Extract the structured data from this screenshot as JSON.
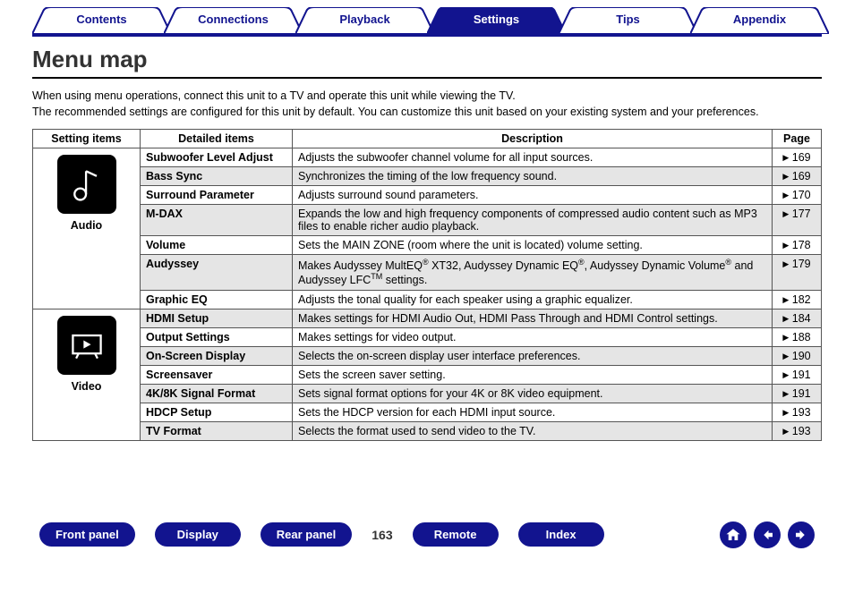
{
  "tabs": [
    {
      "label": "Contents",
      "active": false
    },
    {
      "label": "Connections",
      "active": false
    },
    {
      "label": "Playback",
      "active": false
    },
    {
      "label": "Settings",
      "active": true
    },
    {
      "label": "Tips",
      "active": false
    },
    {
      "label": "Appendix",
      "active": false
    }
  ],
  "title": "Menu map",
  "intro_line1": "When using menu operations, connect this unit to a TV and operate this unit while viewing the TV.",
  "intro_line2": "The recommended settings are configured for this unit by default. You can customize this unit based on your existing system and your preferences.",
  "headers": {
    "setting": "Setting items",
    "detail": "Detailed items",
    "desc": "Description",
    "page": "Page"
  },
  "categories": [
    {
      "name": "Audio",
      "icon": "audio",
      "rows": [
        {
          "shaded": false,
          "detail": "Subwoofer Level Adjust",
          "desc_html": "Adjusts the subwoofer channel volume for all input sources.",
          "page": "169"
        },
        {
          "shaded": true,
          "detail": "Bass Sync",
          "desc_html": "Synchronizes the timing of the low frequency sound.",
          "page": "169"
        },
        {
          "shaded": false,
          "detail": "Surround Parameter",
          "desc_html": "Adjusts surround sound parameters.",
          "page": "170"
        },
        {
          "shaded": true,
          "detail": "M-DAX",
          "desc_html": "Expands the low and high frequency components of compressed audio content such as MP3 files to enable richer audio playback.",
          "page": "177"
        },
        {
          "shaded": false,
          "detail": "Volume",
          "desc_html": "Sets the MAIN ZONE (room where the unit is located) volume setting.",
          "page": "178"
        },
        {
          "shaded": true,
          "detail": "Audyssey",
          "desc_html": "Makes Audyssey MultEQ<sup>®</sup> XT32, Audyssey Dynamic EQ<sup>®</sup>, Audyssey Dynamic Volume<sup>®</sup> and Audyssey LFC<sup>TM</sup> settings.",
          "page": "179"
        },
        {
          "shaded": false,
          "detail": "Graphic EQ",
          "desc_html": "Adjusts the tonal quality for each speaker using a graphic equalizer.",
          "page": "182"
        }
      ]
    },
    {
      "name": "Video",
      "icon": "video",
      "rows": [
        {
          "shaded": true,
          "detail": "HDMI Setup",
          "desc_html": "Makes settings for HDMI Audio Out, HDMI Pass Through and HDMI Control settings.",
          "page": "184"
        },
        {
          "shaded": false,
          "detail": "Output Settings",
          "desc_html": "Makes settings for video output.",
          "page": "188"
        },
        {
          "shaded": true,
          "detail": "On-Screen Display",
          "desc_html": "Selects the on-screen display user interface preferences.",
          "page": "190"
        },
        {
          "shaded": false,
          "detail": "Screensaver",
          "desc_html": "Sets the screen saver setting.",
          "page": "191"
        },
        {
          "shaded": true,
          "detail": "4K/8K Signal Format",
          "desc_html": "Sets signal format options for your 4K or 8K video equipment.",
          "page": "191"
        },
        {
          "shaded": false,
          "detail": "HDCP Setup",
          "desc_html": "Sets the HDCP version for each HDMI input source.",
          "page": "193"
        },
        {
          "shaded": true,
          "detail": "TV Format",
          "desc_html": "Selects the format used to send video to the TV.",
          "page": "193"
        }
      ]
    }
  ],
  "footer": {
    "front": "Front panel",
    "display": "Display",
    "rear": "Rear panel",
    "remote": "Remote",
    "index": "Index",
    "page_number": "163"
  }
}
